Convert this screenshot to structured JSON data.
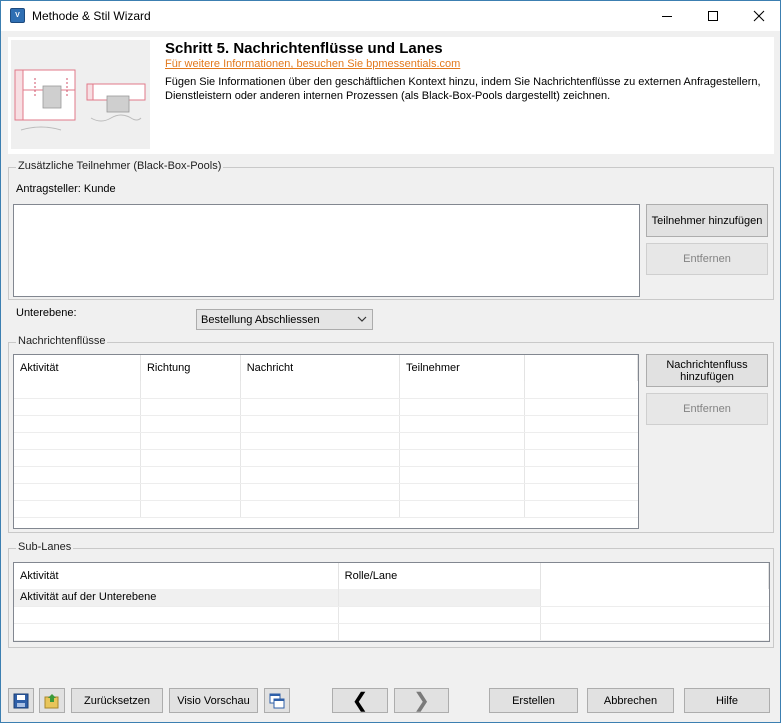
{
  "window": {
    "title": "Methode & Stil Wizard",
    "app_icon_text": "Visio"
  },
  "header": {
    "title": "Schritt 5. Nachrichtenflüsse und Lanes",
    "link": "Für weitere Informationen, besuchen Sie bpmessentials.com",
    "description": "Fügen Sie Informationen über den geschäftlichen Kontext hinzu, indem Sie Nachrichtenflüsse zu externen Anfragestellern, Dienstleistern oder anderen internen Prozessen (als Black-Box-Pools dargestellt) zeichnen."
  },
  "participants": {
    "group_label": "Zusätzliche Teilnehmer (Black-Box-Pools)",
    "requester_label": "Antragsteller: Kunde",
    "add_button": "Teilnehmer hinzufügen",
    "remove_button": "Entfernen"
  },
  "sublevel": {
    "label": "Unterebene:",
    "selected": "Bestellung Abschliessen"
  },
  "message_flows": {
    "group_label": "Nachrichtenflüsse",
    "columns": [
      "Aktivität",
      "Richtung",
      "Nachricht",
      "Teilnehmer"
    ],
    "add_button": "Nachrichtenfluss hinzufügen",
    "remove_button": "Entfernen"
  },
  "sub_lanes": {
    "group_label": "Sub-Lanes",
    "columns": [
      "Aktivität",
      "Rolle/Lane"
    ],
    "rows": [
      [
        "Aktivität auf der Unterebene",
        ""
      ]
    ]
  },
  "footer": {
    "reset_button": "Zurücksetzen",
    "preview_button": "Visio Vorschau",
    "back_glyph": "❮",
    "next_glyph": "❯",
    "create_button": "Erstellen",
    "cancel_button": "Abbrechen",
    "help_button": "Hilfe"
  },
  "colors": {
    "link": "#e2791d",
    "window_border": "#3c7fb1"
  }
}
